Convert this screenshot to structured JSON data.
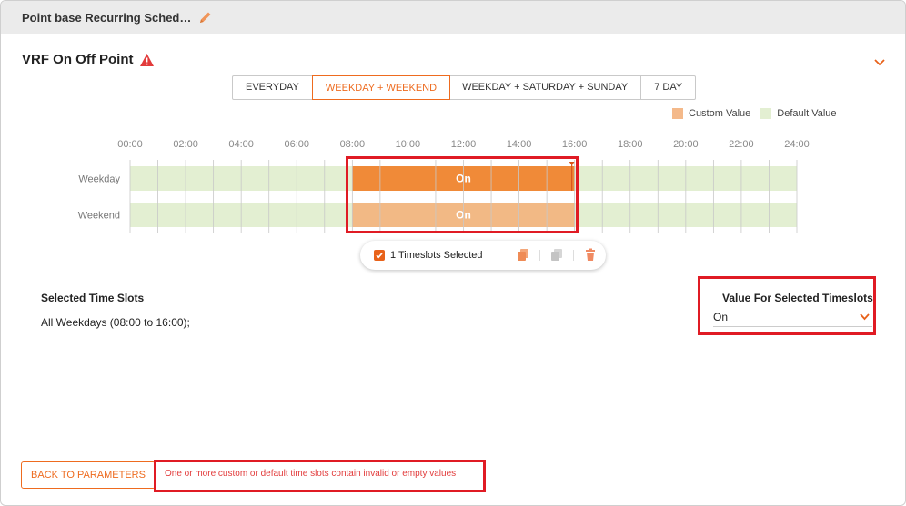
{
  "window": {
    "title": "Point base Recurring Sched…"
  },
  "point": {
    "name": "VRF On Off Point"
  },
  "tabs": [
    {
      "label": "EVERYDAY",
      "active": false
    },
    {
      "label": "WEEKDAY + WEEKEND",
      "active": true
    },
    {
      "label": "WEEKDAY + SATURDAY + SUNDAY",
      "active": false
    },
    {
      "label": "7 DAY",
      "active": false
    }
  ],
  "legend": {
    "custom_label": "Custom Value",
    "default_label": "Default Value",
    "custom_color": "#f4b98a",
    "default_color": "#e3efd2"
  },
  "schedule": {
    "hours": [
      "00:00",
      "02:00",
      "04:00",
      "06:00",
      "08:00",
      "10:00",
      "12:00",
      "14:00",
      "16:00",
      "18:00",
      "20:00",
      "22:00",
      "24:00"
    ],
    "rows": [
      {
        "label": "Weekday",
        "slot_start_hour": 8,
        "slot_end_hour": 16,
        "slot_value": "On",
        "selected": true
      },
      {
        "label": "Weekend",
        "slot_start_hour": 8,
        "slot_end_hour": 16,
        "slot_value": "On",
        "selected": false
      }
    ],
    "colors": {
      "selected": "#f08a38",
      "custom": "#f2b985",
      "default": "#e3efd2",
      "gridline": "#c8c8c8"
    }
  },
  "timeslot_toolbar": {
    "label": "1 Timeslots Selected",
    "checked": true
  },
  "selected_slots": {
    "heading": "Selected Time Slots",
    "text": "All Weekdays (08:00 to 16:00);"
  },
  "value_panel": {
    "heading": "Value For Selected Timeslots",
    "value": "On"
  },
  "footer": {
    "back_label": "BACK TO PARAMETERS",
    "error": "One or more custom or default time slots contain invalid or empty values"
  }
}
